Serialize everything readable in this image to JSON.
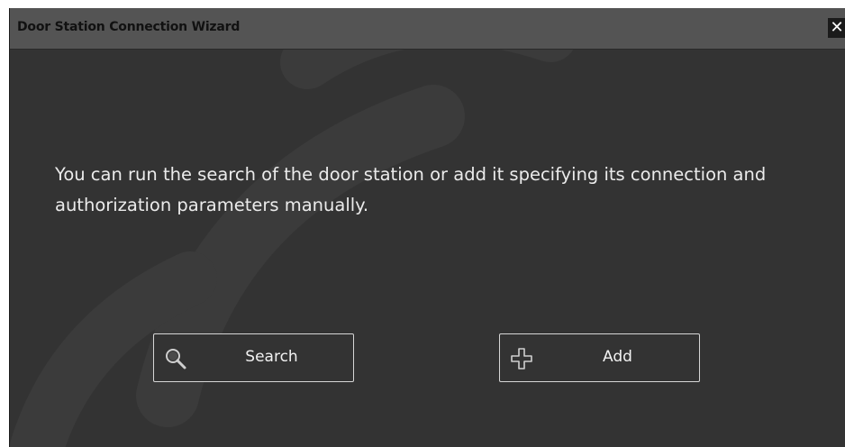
{
  "window": {
    "title": "Door Station Connection Wizard",
    "close_glyph": "✕"
  },
  "main": {
    "message": "You can run the search of the door station or add it specifying its connection and authorization parameters manually."
  },
  "buttons": {
    "search": {
      "label": "Search",
      "icon": "search-icon"
    },
    "add": {
      "label": "Add",
      "icon": "plus-icon"
    }
  },
  "colors": {
    "background": "#333333",
    "titlebar": "#545454",
    "text": "#ebebeb",
    "button_border": "#d6d6d6"
  }
}
